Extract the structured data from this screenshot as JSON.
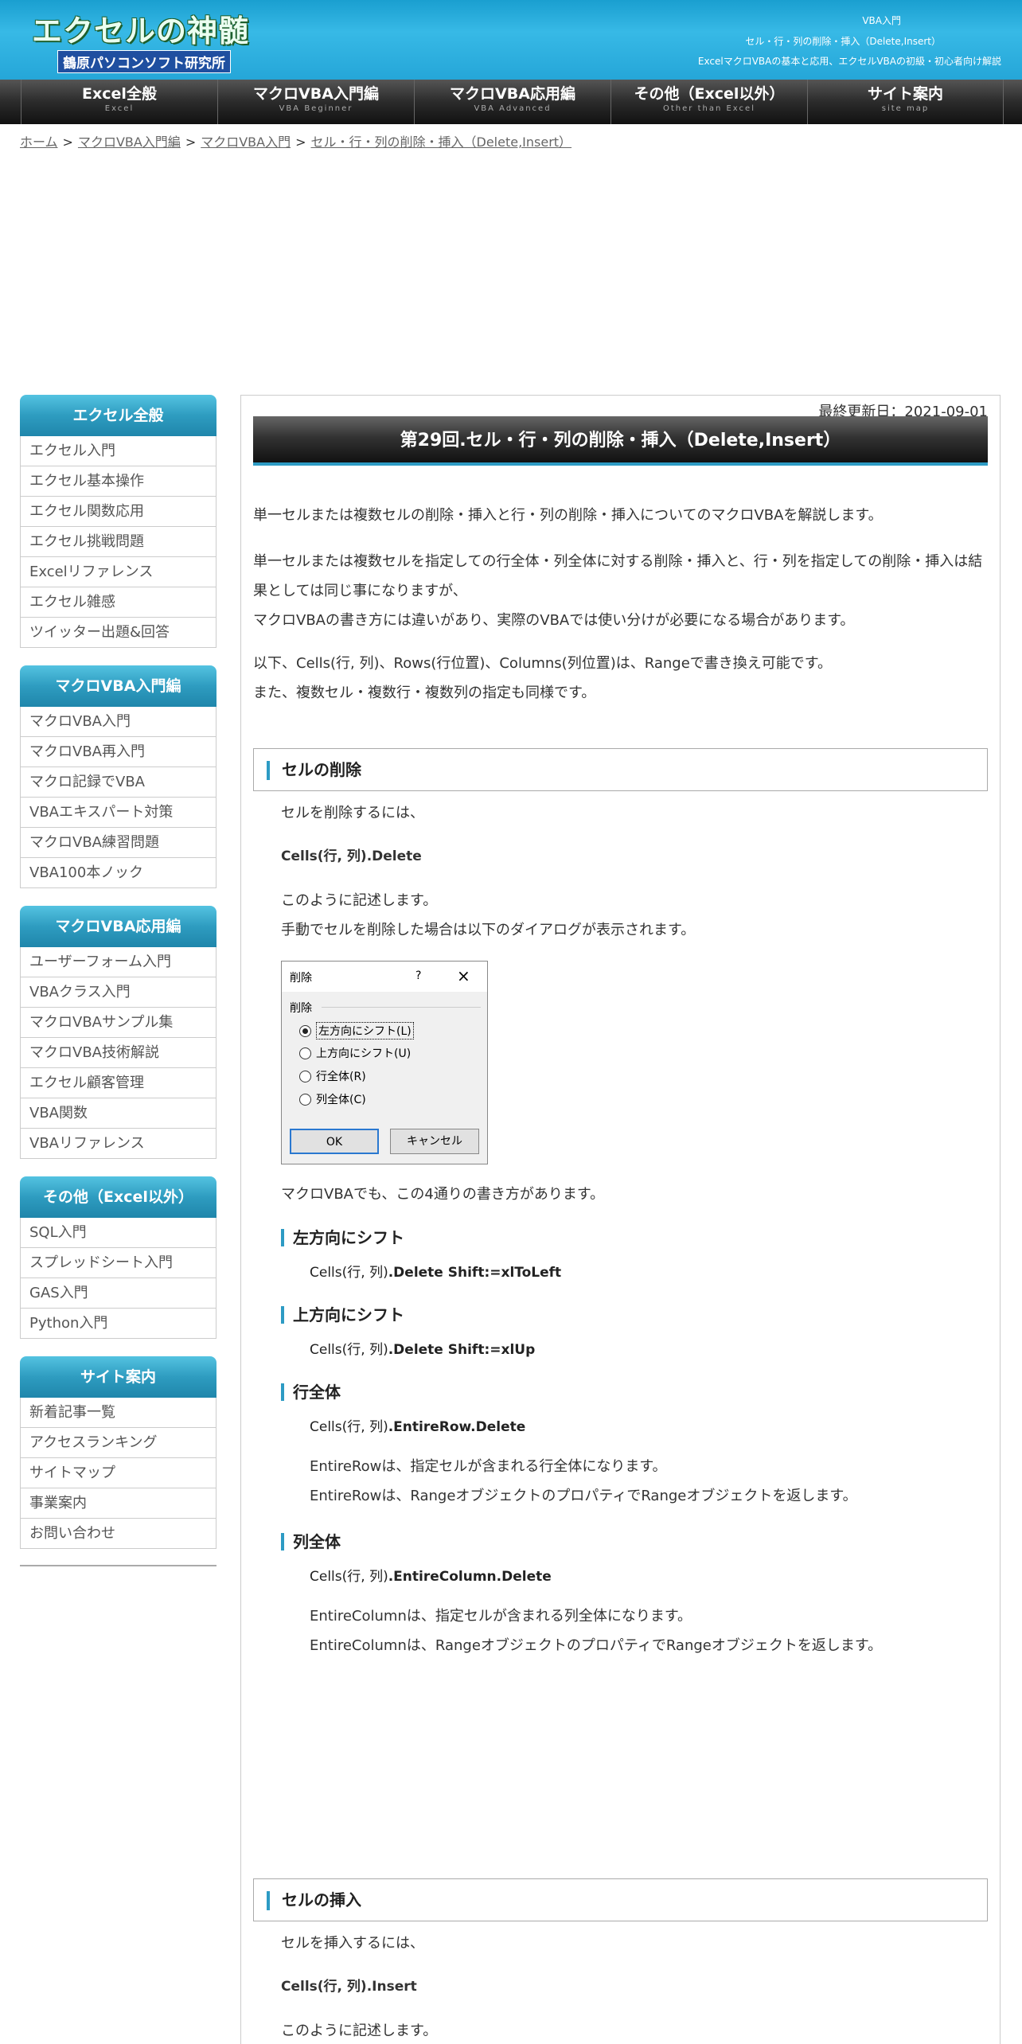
{
  "header": {
    "logo": "エクセルの神髄",
    "logo_sub": "鶴原パソコンソフト研究所",
    "right_line1": "VBA入門",
    "right_line2": "セル・行・列の削除・挿入（Delete,Insert）",
    "right_line3": "ExcelマクロVBAの基本と応用、エクセルVBAの初級・初心者向け解説"
  },
  "nav": [
    {
      "label": "Excel全般",
      "sub": "Excel"
    },
    {
      "label": "マクロVBA入門編",
      "sub": "VBA Beginner"
    },
    {
      "label": "マクロVBA応用編",
      "sub": "VBA Advanced"
    },
    {
      "label": "その他（Excel以外）",
      "sub": "Other than Excel"
    },
    {
      "label": "サイト案内",
      "sub": "site map"
    }
  ],
  "breadcrumb": [
    "ホーム",
    "マクロVBA入門編",
    "マクロVBA入門",
    "セル・行・列の削除・挿入（Delete,Insert）"
  ],
  "breadcrumb_sep": ">",
  "sidebar": [
    {
      "title": "エクセル全般",
      "items": [
        "エクセル入門",
        "エクセル基本操作",
        "エクセル関数応用",
        "エクセル挑戦問題",
        "Excelリファレンス",
        "エクセル雑感",
        "ツイッター出題&回答"
      ]
    },
    {
      "title": "マクロVBA入門編",
      "items": [
        "マクロVBA入門",
        "マクロVBA再入門",
        "マクロ記録でVBA",
        "VBAエキスパート対策",
        "マクロVBA練習問題",
        "VBA100本ノック"
      ]
    },
    {
      "title": "マクロVBA応用編",
      "items": [
        "ユーザーフォーム入門",
        "VBAクラス入門",
        "マクロVBAサンプル集",
        "マクロVBA技術解説",
        "エクセル顧客管理",
        "VBA関数",
        "VBAリファレンス"
      ]
    },
    {
      "title": "その他（Excel以外）",
      "items": [
        "SQL入門",
        "スプレッドシート入門",
        "GAS入門",
        "Python入門"
      ]
    },
    {
      "title": "サイト案内",
      "items": [
        "新着記事一覧",
        "アクセスランキング",
        "サイトマップ",
        "事業案内",
        "お問い合わせ"
      ]
    }
  ],
  "main": {
    "updated": "最終更新日：2021-09-01",
    "title": "第29回.セル・行・列の削除・挿入（Delete,Insert）",
    "intro1": "単一セルまたは複数セルの削除・挿入と行・列の削除・挿入についてのマクロVBAを解説します。",
    "intro2a": "単一セルまたは複数セルを指定しての行全体・列全体に対する削除・挿入と、行・列を指定しての削除・挿入は結",
    "intro2b": "果としては同じ事になりますが、",
    "intro2c": "マクロVBAの書き方には違いがあり、実際のVBAでは使い分けが必要になる場合があります。",
    "intro3a": "以下、Cells(行, 列)、Rows(行位置)、Columns(列位置)は、Rangeで書き換え可能です。",
    "intro3b": "また、複数セル・複数行・複数列の指定も同様です。",
    "sec_delete": "セルの削除",
    "del_p1": "セルを削除するには、",
    "del_code": "Cells(行, 列).Delete",
    "del_p2": "このように記述します。",
    "del_p3": "手動でセルを削除した場合は以下のダイアログが表示されます。",
    "dialog": {
      "title": "削除",
      "help": "?",
      "group": "削除",
      "options": [
        "左方向にシフト(L)",
        "上方向にシフト(U)",
        "行全体(R)",
        "列全体(C)"
      ],
      "ok": "OK",
      "cancel": "キャンセル"
    },
    "del_p4": "マクロVBAでも、この4通りの書き方があります。",
    "subs": [
      {
        "title": "左方向にシフト",
        "code_pre": "Cells(行, 列)",
        "code_bold": ".Delete Shift:=xlToLeft"
      },
      {
        "title": "上方向にシフト",
        "code_pre": "Cells(行, 列)",
        "code_bold": ".Delete Shift:=xlUp"
      },
      {
        "title": "行全体",
        "code_pre": "Cells(行, 列)",
        "code_bold": ".EntireRow.Delete"
      },
      {
        "title": "列全体",
        "code_pre": "Cells(行, 列)",
        "code_bold": ".EntireColumn.Delete"
      }
    ],
    "row_note1": "EntireRowは、指定セルが含まれる行全体になります。",
    "row_note2": "EntireRowは、RangeオブジェクトのプロパティでRangeオブジェクトを返します。",
    "col_note1": "EntireColumnは、指定セルが含まれる列全体になります。",
    "col_note2": "EntireColumnは、RangeオブジェクトのプロパティでRangeオブジェクトを返します。",
    "sec_insert": "セルの挿入",
    "ins_p1": "セルを挿入するには、",
    "ins_code": "Cells(行, 列).Insert",
    "ins_p2": "このように記述します。"
  }
}
